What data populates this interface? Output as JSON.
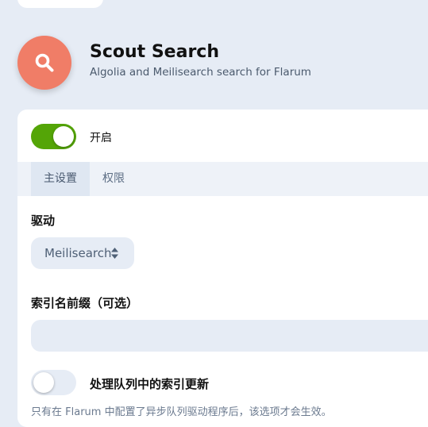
{
  "extension": {
    "title": "Scout Search",
    "description": "Algolia and Meilisearch search for Flarum",
    "icon": "search-icon",
    "icon_bg": "#f07d67"
  },
  "enable": {
    "label": "开启",
    "on": true,
    "color": "#54a507"
  },
  "tabs": [
    {
      "label": "主设置",
      "active": true
    },
    {
      "label": "权限",
      "active": false
    }
  ],
  "driver": {
    "label": "驱动",
    "value": "Meilisearch",
    "icon": "sort-caret-icon"
  },
  "prefix": {
    "label": "索引名前缀（可选）",
    "value": ""
  },
  "queue": {
    "label": "处理队列中的索引更新",
    "on": false,
    "help": "只有在 Flarum 中配置了异步队列驱动程序后，该选项才会生效。"
  }
}
